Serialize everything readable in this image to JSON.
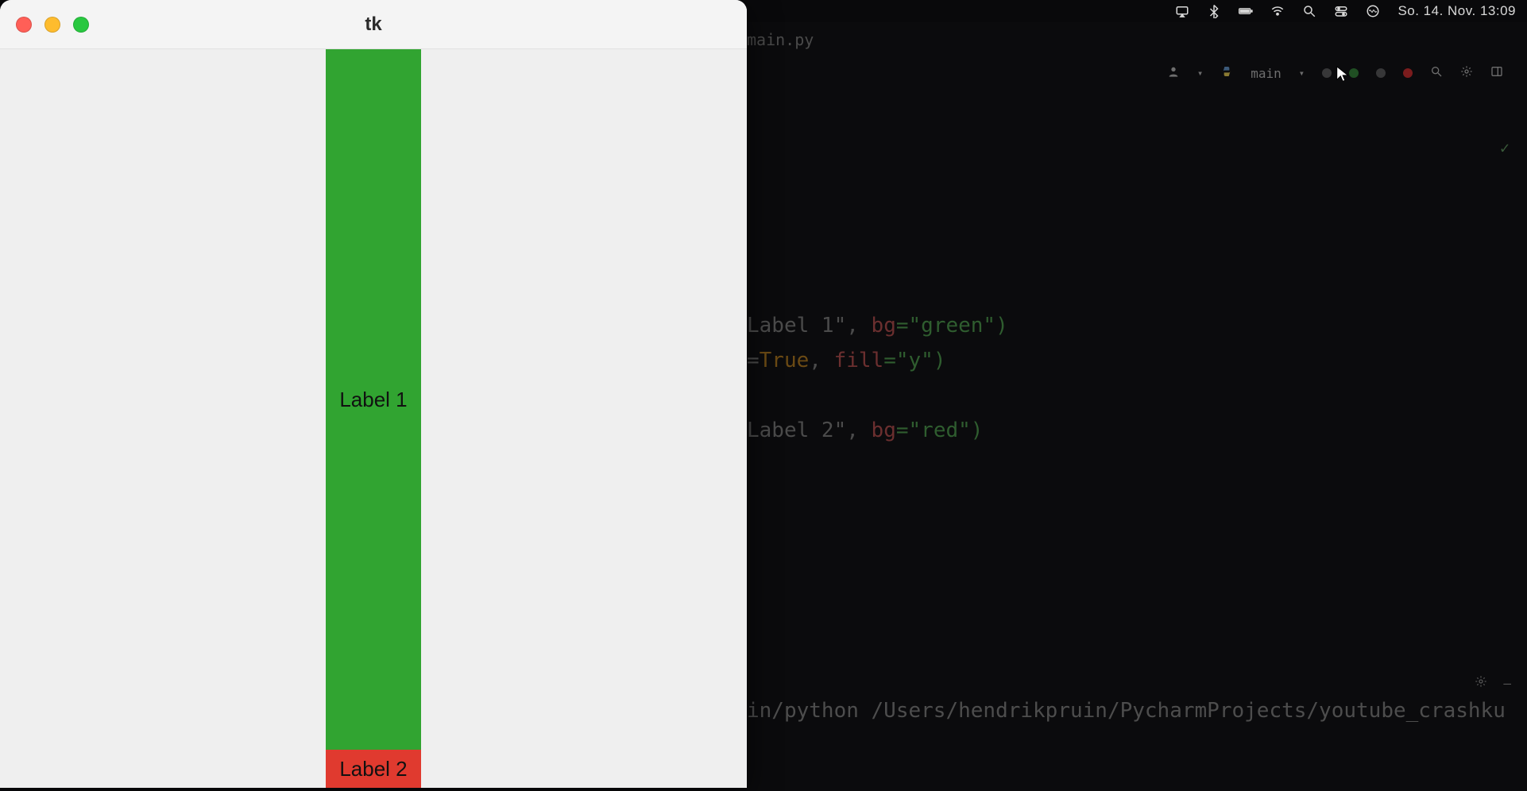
{
  "menubar": {
    "clock": "So. 14. Nov. 13:09"
  },
  "ide": {
    "tab_label": "main.py",
    "run_config": "main",
    "check_mark": "✓",
    "code_line1_a": "Label 1\", ",
    "code_line1_b": "bg",
    "code_line1_c": "=\"green\")",
    "code_line2_a": "=",
    "code_line2_b": "True",
    "code_line2_c": ", ",
    "code_line2_d": "fill",
    "code_line2_e": "=\"y\")",
    "code_line3_a": "Label 2\", ",
    "code_line3_b": "bg",
    "code_line3_c": "=\"red\")",
    "console_text": "in/python /Users/hendrikpruin/PycharmProjects/youtube_crashku"
  },
  "tk": {
    "title": "tk",
    "label1_text": "Label 1",
    "label1_bg": "#31a431",
    "label2_text": "Label 2",
    "label2_bg": "#e03a2f"
  }
}
